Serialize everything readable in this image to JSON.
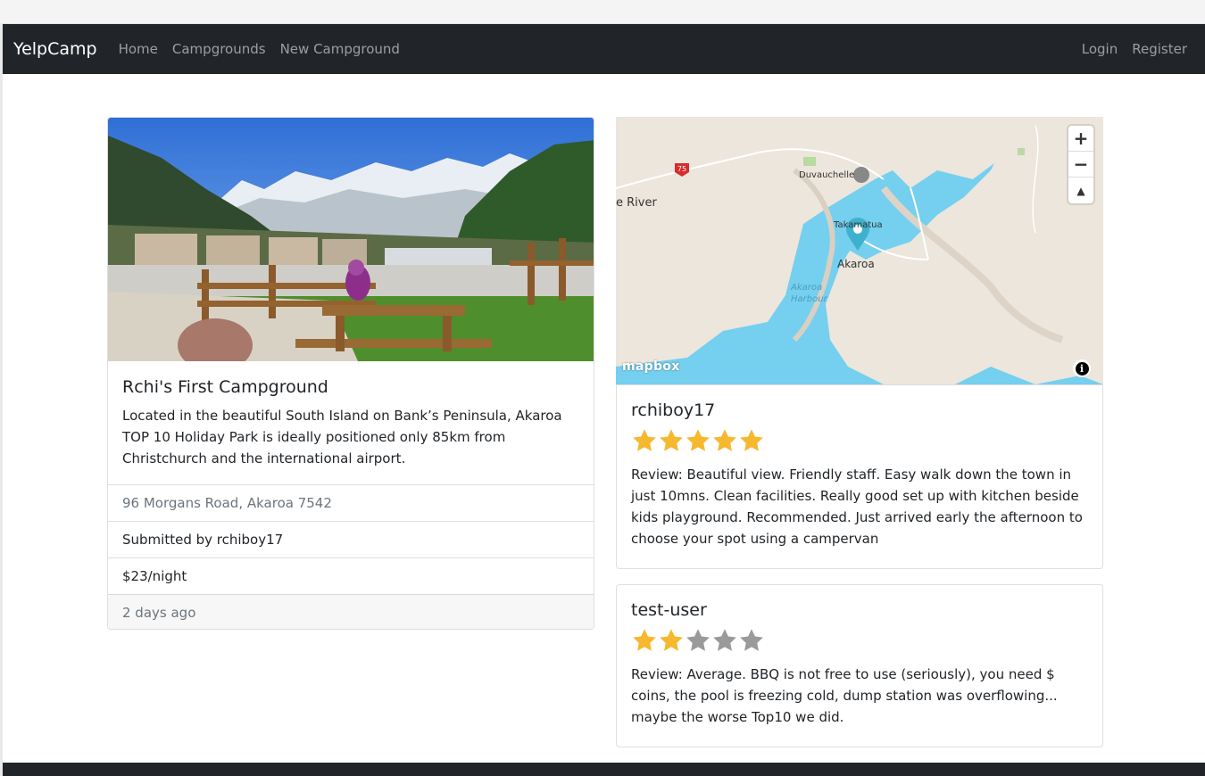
{
  "navbar": {
    "brand": "YelpCamp",
    "links": [
      "Home",
      "Campgrounds",
      "New Campground"
    ],
    "right_links": [
      "Login",
      "Register"
    ]
  },
  "campground": {
    "image_alt": "Campground with picnic tables and snowy mountains",
    "title": "Rchi's First Campground",
    "description": "Located in the beautiful South Island on Bank’s Peninsula, Akaroa TOP 10 Holiday Park is ideally positioned only 85km from Christchurch and the international airport.",
    "location": "96 Morgans Road, Akaroa 7542",
    "submitted_by": "Submitted by rchiboy17",
    "price": "$23/night",
    "posted": "2 days ago"
  },
  "map": {
    "labels": {
      "river": "e River",
      "duvauchelle": "Duvauchelle",
      "takamatua": "Takamatua",
      "akaroa": "Akaroa",
      "harbour": "Akaroa\nHarbour",
      "route": "75"
    },
    "zoom_in": "+",
    "zoom_out": "−",
    "compass": "▲",
    "logo": "mapbox",
    "info": "i",
    "colors": {
      "water": "#75cfef",
      "land": "#ece6dc",
      "marker": "#3fb1ce"
    }
  },
  "reviews": [
    {
      "user": "rchiboy17",
      "rating": 5,
      "max": 5,
      "text": "Review: Beautiful view. Friendly staff. Easy walk down the town in just 10mns. Clean facilities. Really good set up with kitchen beside kids playground. Recommended. Just arrived early the afternoon to choose your spot using a campervan"
    },
    {
      "user": "test-user",
      "rating": 2,
      "max": 5,
      "text": "Review: Average. BBQ is not free to use (seriously), you need $ coins, the pool is freezing cold, dump station was overflowing... maybe the worse Top10 we did."
    }
  ],
  "colors": {
    "navbar": "#212529",
    "star_filled": "#f5b82e",
    "star_empty": "#9a9a9a"
  }
}
